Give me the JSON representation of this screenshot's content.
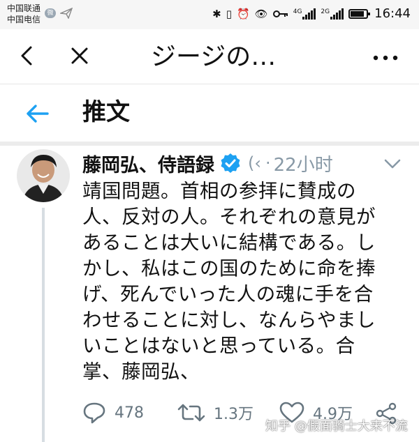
{
  "status_bar": {
    "carrier_1": "中国联通",
    "carrier_2": "中国电信",
    "notification_icons": [
      "weibo-icon",
      "paper-plane-icon"
    ],
    "system_icons": [
      "bluetooth-icon",
      "vibrate-icon",
      "alarm-icon",
      "eye-icon",
      "key-icon",
      "4g-signal-icon",
      "2g-signal-icon",
      "battery-icon"
    ],
    "net_4g": "4G",
    "net_2g": "2G",
    "battery_level": 0.85,
    "time": "16:44"
  },
  "top_nav": {
    "title": "ジージの…"
  },
  "tweet_bar": {
    "heading": "推文"
  },
  "tweet": {
    "author_name": "藤岡弘、侍語録",
    "handle": "(‹",
    "separator": "·",
    "time": "22小时",
    "body_lines": [
      "靖国問題。首相の参拝に賛成の",
      "人、反対の人。それぞれの意見が",
      "あることは大いに結構である。し",
      "かし、私はこの国のために命を捧",
      "げ、死んでいった人の魂に手を合",
      "わせることに対し、なんらやまし",
      "いことはないと思っている。合",
      "掌、藤岡弘、"
    ],
    "replies": "478",
    "retweets": "1.3万",
    "likes": "4.9万"
  },
  "watermark": "知乎 @假面骑士大来不流",
  "colors": {
    "accent": "#1da1f2",
    "muted": "#8899a6",
    "divider": "#ececec"
  }
}
